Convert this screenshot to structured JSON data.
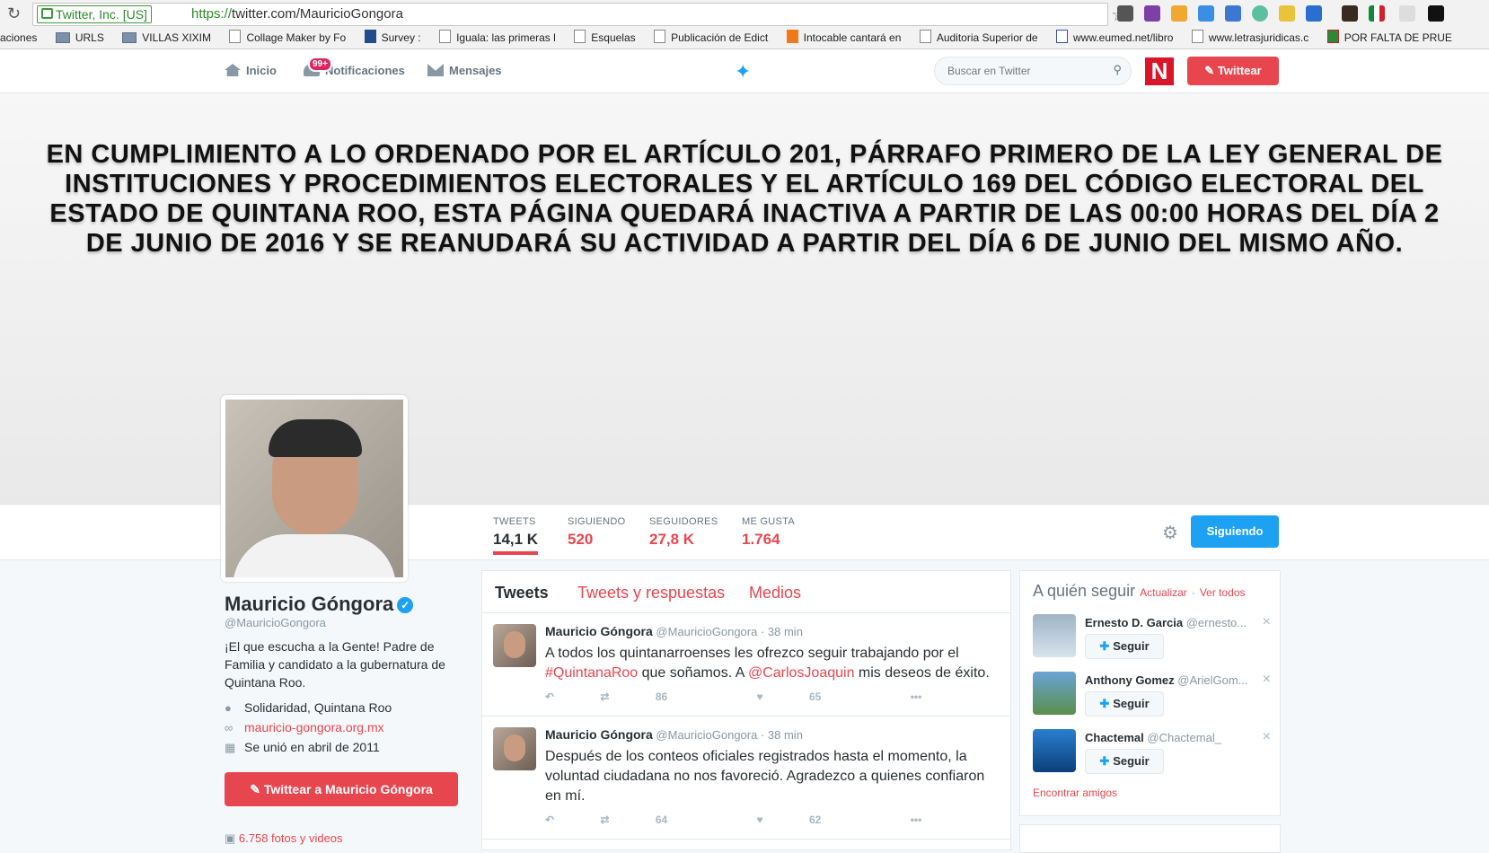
{
  "browser": {
    "cert_label": "Twitter, Inc. [US]",
    "url_scheme": "https://",
    "url_rest": "twitter.com/MauricioGongora",
    "bookmarks": [
      "aciones",
      "URLS",
      "VILLAS XIXIM",
      "Collage Maker by Fo",
      "Survey :",
      "Iguala: las primeras l",
      "Esquelas",
      "Publicación de Edict",
      "Intocable cantará en",
      "Auditoria Superior de",
      "www.eumed.net/libro",
      "www.letrasjuridicas.c",
      "POR FALTA DE PRUE"
    ]
  },
  "nav": {
    "home": "Inicio",
    "notifications": "Notificaciones",
    "notifications_badge": "99+",
    "messages": "Mensajes",
    "search_placeholder": "Buscar en Twitter",
    "n_logo": "N",
    "tweet_button": "Twittear"
  },
  "banner": {
    "text": "EN CUMPLIMIENTO A LO ORDENADO POR EL ARTÍCULO 201, PÁRRAFO PRIMERO DE LA LEY GENERAL DE INSTITUCIONES Y PROCEDIMIENTOS ELECTORALES Y EL ARTÍCULO 169 DEL CÓDIGO ELECTORAL DEL ESTADO DE QUINTANA ROO, ESTA PÁGINA QUEDARÁ INACTIVA A PARTIR DE LAS 00:00 HORAS DEL DÍA 2 DE JUNIO DE 2016 Y SE REANUDARÁ SU ACTIVIDAD A PARTIR DEL DÍA 6 DE JUNIO DEL MISMO AÑO."
  },
  "stats": [
    {
      "label": "TWEETS",
      "value": "14,1 K"
    },
    {
      "label": "SIGUIENDO",
      "value": "520"
    },
    {
      "label": "SEGUIDORES",
      "value": "27,8 K"
    },
    {
      "label": "ME GUSTA",
      "value": "1.764"
    }
  ],
  "follow_button": "Siguiendo",
  "profile": {
    "name": "Mauricio Góngora",
    "handle": "@MauricioGongora",
    "bio": "¡El que escucha a la Gente! Padre de Familia y candidato a la gubernatura de Quintana Roo.",
    "location": "Solidaridad, Quintana Roo",
    "website": "mauricio-gongora.org.mx",
    "joined": "Se unió en abril de 2011",
    "tweet_to": "Twittear a Mauricio Góngora",
    "photos": "6.758 fotos y videos"
  },
  "timeline": {
    "tabs": [
      "Tweets",
      "Tweets y respuestas",
      "Medios"
    ],
    "tweets": [
      {
        "name": "Mauricio Góngora",
        "handle": "@MauricioGongora",
        "time": "· 38 min",
        "text_1": "A todos los quintanarroenses les ofrezco seguir trabajando por el ",
        "hashtag": "#QuintanaRoo",
        "text_2": " que soñamos. A ",
        "mention": "@CarlosJoaquin",
        "text_3": " mis deseos de éxito.",
        "retweets": "86",
        "likes": "65"
      },
      {
        "name": "Mauricio Góngora",
        "handle": "@MauricioGongora",
        "time": "· 38 min",
        "text": "Después de los conteos oficiales registrados hasta el momento, la voluntad ciudadana no nos favoreció. Agradezco a quienes confiaron en mí.",
        "retweets": "64",
        "likes": "62"
      }
    ]
  },
  "who_to_follow": {
    "title": "A quién seguir",
    "refresh": "Actualizar",
    "view_all": "Ver todos",
    "follow_label": "Seguir",
    "suggestions": [
      {
        "name": "Ernesto D. Garcia",
        "handle": "@ernesto..."
      },
      {
        "name": "Anthony Gomez",
        "handle": "@ArielGom..."
      },
      {
        "name": "Chactemal",
        "handle": "@Chactemal_"
      }
    ],
    "find_friends": "Encontrar amigos"
  }
}
